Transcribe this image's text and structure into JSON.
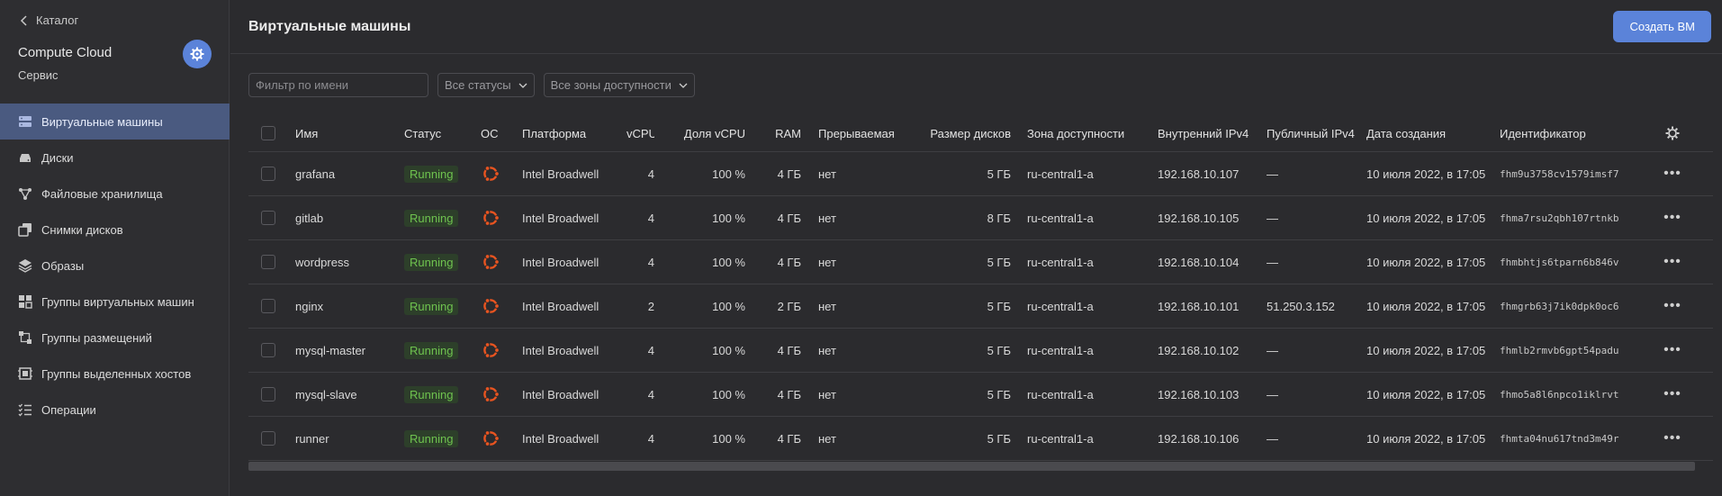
{
  "sidebar": {
    "back_label": "Каталог",
    "service_title": "Compute Cloud",
    "service_subtitle": "Сервис",
    "items": [
      {
        "label": "Виртуальные машины",
        "icon": "server-icon",
        "active": true
      },
      {
        "label": "Диски",
        "icon": "disk-icon",
        "active": false
      },
      {
        "label": "Файловые хранилища",
        "icon": "file-storage-icon",
        "active": false
      },
      {
        "label": "Снимки дисков",
        "icon": "snapshot-icon",
        "active": false
      },
      {
        "label": "Образы",
        "icon": "layers-icon",
        "active": false
      },
      {
        "label": "Группы виртуальных машин",
        "icon": "instance-group-icon",
        "active": false
      },
      {
        "label": "Группы размещений",
        "icon": "placement-group-icon",
        "active": false
      },
      {
        "label": "Группы выделенных хостов",
        "icon": "dedicated-host-icon",
        "active": false
      },
      {
        "label": "Операции",
        "icon": "operations-list-icon",
        "active": false
      }
    ]
  },
  "header": {
    "title": "Виртуальные машины",
    "create_button": "Создать ВМ"
  },
  "filters": {
    "name_placeholder": "Фильтр по имени",
    "status_select": "Все статусы",
    "zone_select": "Все зоны доступности"
  },
  "table": {
    "columns": [
      "Имя",
      "Статус",
      "ОС",
      "Платформа",
      "vCPU",
      "Доля vCPU",
      "RAM",
      "Прерываемая",
      "Размер дисков",
      "Зона доступности",
      "Внутренний IPv4",
      "Публичный IPv4",
      "Дата создания",
      "Идентификатор"
    ],
    "rows": [
      {
        "name": "grafana",
        "status": "Running",
        "os": "ubuntu-icon",
        "platform": "Intel Broadwell",
        "vcpu": "4",
        "share": "100 %",
        "ram": "4 ГБ",
        "preemptible": "нет",
        "disk": "5 ГБ",
        "zone": "ru-central1-a",
        "internal_ip": "192.168.10.107",
        "public_ip": "—",
        "created": "10 июля 2022, в 17:05",
        "id": "fhm9u3758cv1579imsf7"
      },
      {
        "name": "gitlab",
        "status": "Running",
        "os": "ubuntu-icon",
        "platform": "Intel Broadwell",
        "vcpu": "4",
        "share": "100 %",
        "ram": "4 ГБ",
        "preemptible": "нет",
        "disk": "8 ГБ",
        "zone": "ru-central1-a",
        "internal_ip": "192.168.10.105",
        "public_ip": "—",
        "created": "10 июля 2022, в 17:05",
        "id": "fhma7rsu2qbh107rtnkb"
      },
      {
        "name": "wordpress",
        "status": "Running",
        "os": "ubuntu-icon",
        "platform": "Intel Broadwell",
        "vcpu": "4",
        "share": "100 %",
        "ram": "4 ГБ",
        "preemptible": "нет",
        "disk": "5 ГБ",
        "zone": "ru-central1-a",
        "internal_ip": "192.168.10.104",
        "public_ip": "—",
        "created": "10 июля 2022, в 17:05",
        "id": "fhmbhtjs6tparn6b846v"
      },
      {
        "name": "nginx",
        "status": "Running",
        "os": "ubuntu-icon",
        "platform": "Intel Broadwell",
        "vcpu": "2",
        "share": "100 %",
        "ram": "2 ГБ",
        "preemptible": "нет",
        "disk": "5 ГБ",
        "zone": "ru-central1-a",
        "internal_ip": "192.168.10.101",
        "public_ip": "51.250.3.152",
        "created": "10 июля 2022, в 17:05",
        "id": "fhmgrb63j7ik0dpk0oc6"
      },
      {
        "name": "mysql-master",
        "status": "Running",
        "os": "ubuntu-icon",
        "platform": "Intel Broadwell",
        "vcpu": "4",
        "share": "100 %",
        "ram": "4 ГБ",
        "preemptible": "нет",
        "disk": "5 ГБ",
        "zone": "ru-central1-a",
        "internal_ip": "192.168.10.102",
        "public_ip": "—",
        "created": "10 июля 2022, в 17:05",
        "id": "fhmlb2rmvb6gpt54padu"
      },
      {
        "name": "mysql-slave",
        "status": "Running",
        "os": "ubuntu-icon",
        "platform": "Intel Broadwell",
        "vcpu": "4",
        "share": "100 %",
        "ram": "4 ГБ",
        "preemptible": "нет",
        "disk": "5 ГБ",
        "zone": "ru-central1-a",
        "internal_ip": "192.168.10.103",
        "public_ip": "—",
        "created": "10 июля 2022, в 17:05",
        "id": "fhmo5a8l6npco1iklrvt"
      },
      {
        "name": "runner",
        "status": "Running",
        "os": "ubuntu-icon",
        "platform": "Intel Broadwell",
        "vcpu": "4",
        "share": "100 %",
        "ram": "4 ГБ",
        "preemptible": "нет",
        "disk": "5 ГБ",
        "zone": "ru-central1-a",
        "internal_ip": "192.168.10.106",
        "public_ip": "—",
        "created": "10 июля 2022, в 17:05",
        "id": "fhmta04nu617tnd3m49r"
      }
    ]
  },
  "colors": {
    "background": "#2b2b2e",
    "accent": "#5b83d9",
    "running_text": "#6fc34f",
    "ubuntu_orange": "#e95420"
  }
}
